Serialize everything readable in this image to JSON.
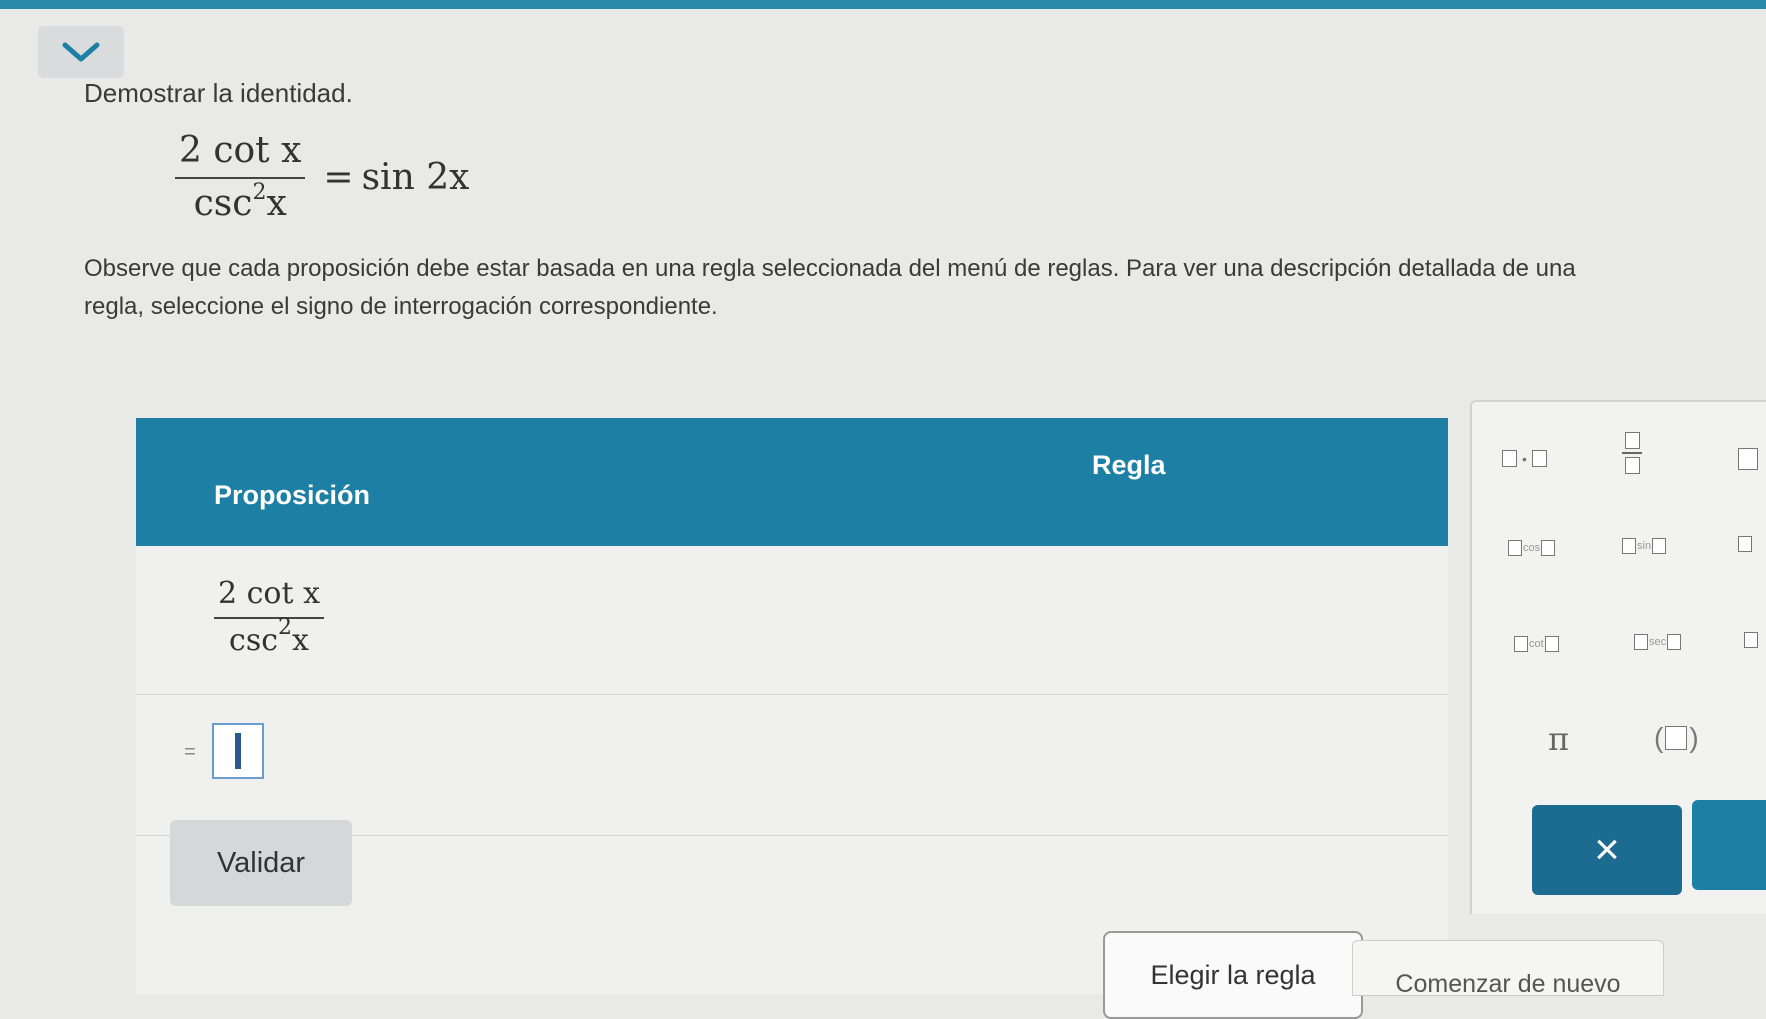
{
  "header": {
    "title": "Demostrar la identidad.",
    "identity": {
      "numerator": "2 cot x",
      "denominator_base": "csc",
      "denominator_exp": "2",
      "denominator_var": "x",
      "equals": "=",
      "rhs": "sin 2x"
    },
    "instructions_line1": "Observe que cada proposición debe estar basada en una regla seleccionada del menú de reglas. Para ver una descripción detallada de una",
    "instructions_line2": "regla, seleccione el signo de interrogación correspondiente."
  },
  "table": {
    "col_proposition": "Proposición",
    "col_rule": "Regla",
    "row1": {
      "numerator": "2 cot x",
      "denominator_base": "csc",
      "denominator_exp": "2",
      "denominator_var": "x"
    },
    "row2": {
      "prefix": "=",
      "choose_rule_label": "Elegir la regla"
    }
  },
  "actions": {
    "validate_label": "Validar",
    "clear_symbol": "×",
    "restart_label": "Comenzar de nuevo"
  },
  "keypad": {
    "keys": {
      "cos": "cos",
      "sin": "sin",
      "cot": "cot",
      "sec": "sec",
      "pi": "π",
      "paren_open": "(",
      "paren_close": ")"
    }
  },
  "colors": {
    "accent": "#1c7fa3",
    "dark_accent": "#1c6b91"
  }
}
